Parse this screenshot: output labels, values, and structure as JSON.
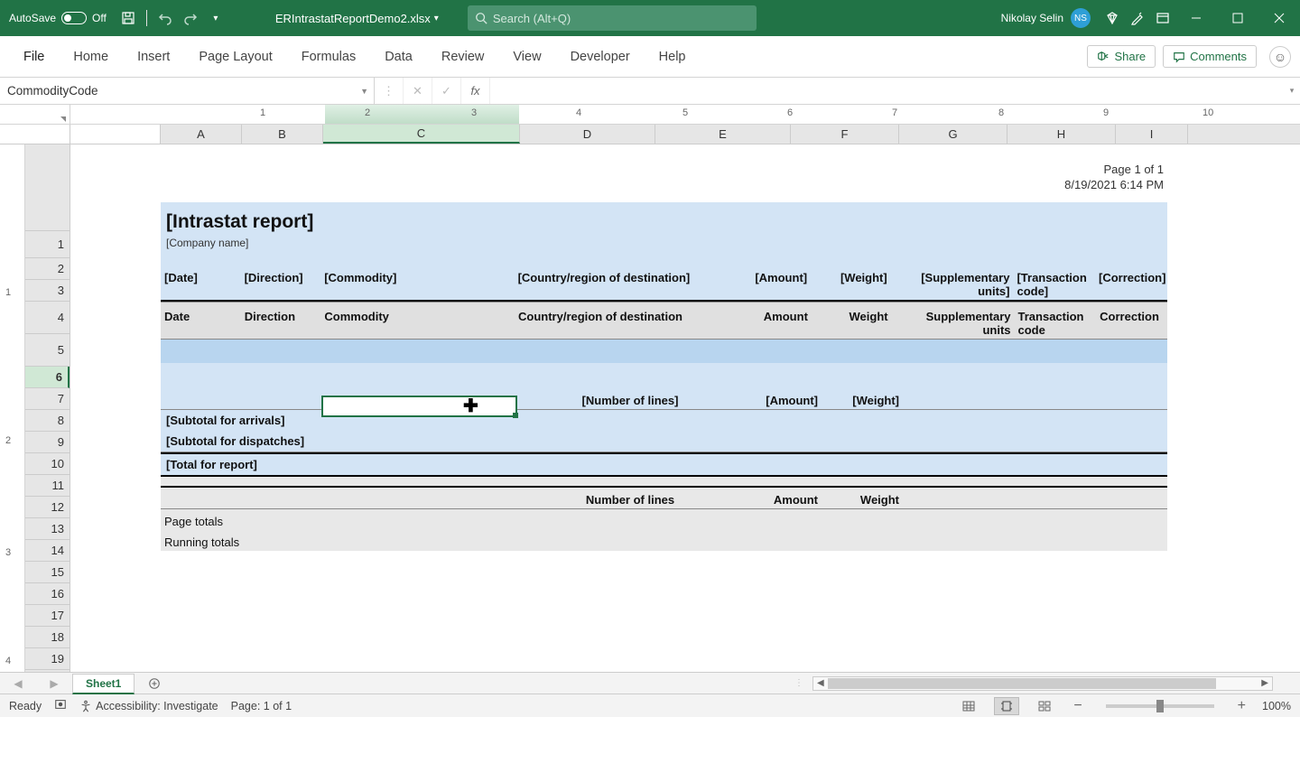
{
  "titlebar": {
    "autosave_label": "AutoSave",
    "autosave_state": "Off",
    "filename": "ERIntrastatReportDemo2.xlsx",
    "search_placeholder": "Search (Alt+Q)",
    "user_name": "Nikolay Selin",
    "user_initials": "NS"
  },
  "ribbon": {
    "tabs": [
      "File",
      "Home",
      "Insert",
      "Page Layout",
      "Formulas",
      "Data",
      "Review",
      "View",
      "Developer",
      "Help"
    ],
    "share": "Share",
    "comments": "Comments"
  },
  "namebox": "CommodityCode",
  "columns": [
    "A",
    "B",
    "C",
    "D",
    "E",
    "F",
    "G",
    "H",
    "I"
  ],
  "rows": [
    "1",
    "2",
    "3",
    "4",
    "5",
    "6",
    "7",
    "8",
    "9",
    "10",
    "11",
    "12",
    "13",
    "14",
    "15",
    "16",
    "17",
    "18",
    "19"
  ],
  "ruler_marks": [
    "1",
    "2",
    "3",
    "4",
    "5",
    "6",
    "7",
    "8",
    "9",
    "10"
  ],
  "v_ruler": [
    "1",
    "2",
    "3",
    "4"
  ],
  "page_meta": {
    "page_label": "Page 1 of  1",
    "datetime": "8/19/2021 6:14 PM"
  },
  "report": {
    "title": "[Intrastat report]",
    "company": "[Company name]",
    "template_headers": {
      "date": "[Date]",
      "direction": "[Direction]",
      "commodity": "[Commodity]",
      "country": "[Country/region of destination]",
      "amount": "[Amount]",
      "weight": "[Weight]",
      "supp": "[Supplementary units]",
      "trans": "[Transaction code]",
      "corr": "[Correction]"
    },
    "data_headers": {
      "date": "Date",
      "direction": "Direction",
      "commodity": "Commodity",
      "country": "Country/region of destination",
      "amount": "Amount",
      "weight": "Weight",
      "supp": "Supplementary units",
      "trans": "Transaction code",
      "corr": "Correction"
    },
    "summary_headers": {
      "lines": "[Number of lines]",
      "amount": "[Amount]",
      "weight": "[Weight]"
    },
    "subtotal_arrivals": "[Subtotal for arrivals]",
    "subtotal_dispatches": "[Subtotal for dispatches]",
    "total": "[Total for report]",
    "lower_headers": {
      "lines": "Number of lines",
      "amount": "Amount",
      "weight": "Weight"
    },
    "page_totals": "Page totals",
    "running_totals": "Running totals"
  },
  "sheet_tabs": {
    "active": "Sheet1"
  },
  "statusbar": {
    "ready": "Ready",
    "accessibility": "Accessibility: Investigate",
    "page": "Page: 1 of 1",
    "zoom": "100%"
  }
}
